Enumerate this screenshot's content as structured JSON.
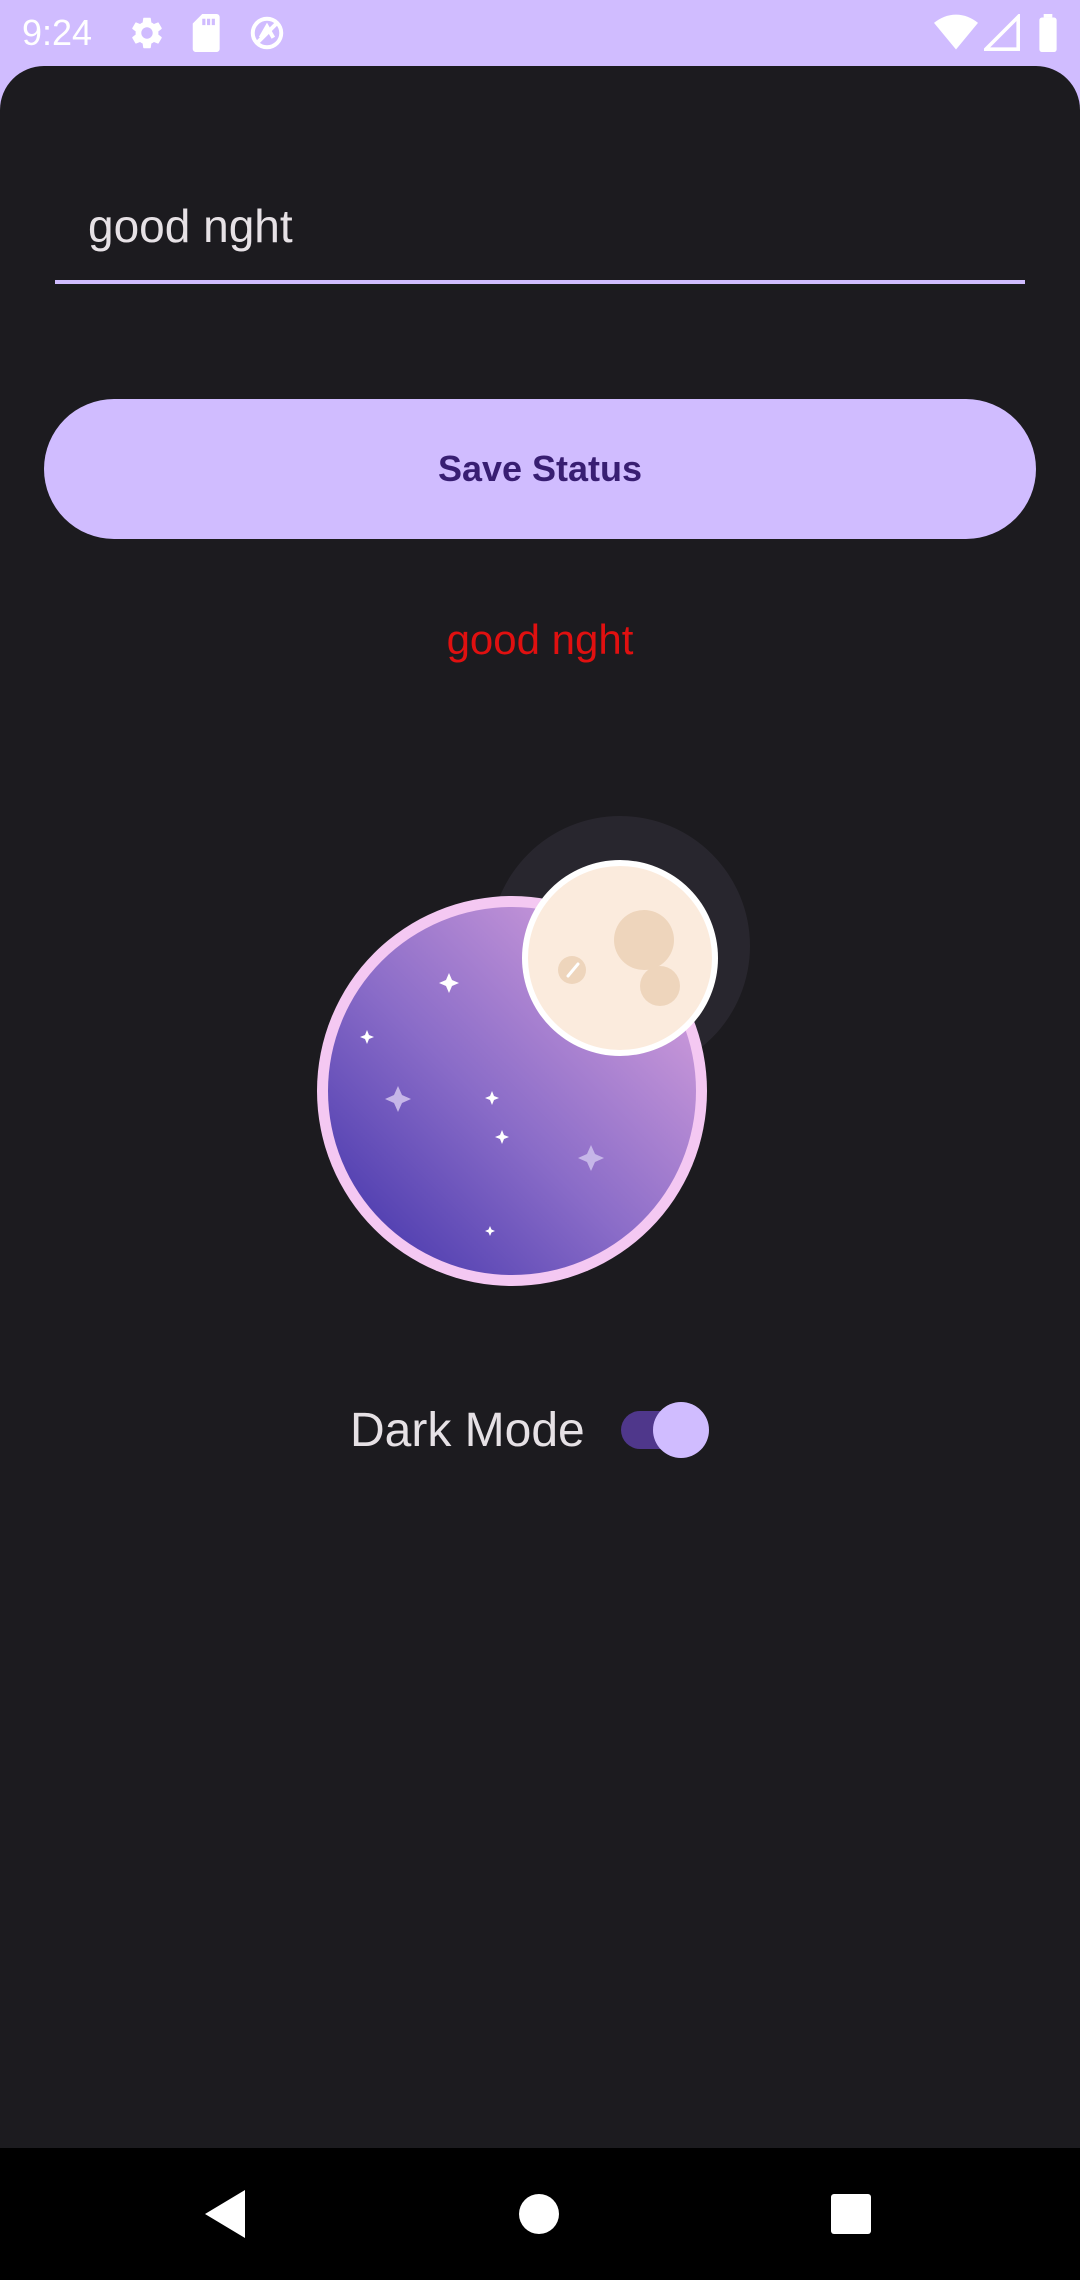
{
  "status_bar": {
    "time": "9:24",
    "icons": [
      "settings-icon",
      "sd-card-icon",
      "vpn-icon",
      "wifi-icon",
      "cell-signal-icon",
      "battery-icon"
    ]
  },
  "status_input": {
    "value": "good nght"
  },
  "save_button": {
    "label": "Save Status"
  },
  "status_display": {
    "text": "good nght",
    "color": "#E01010"
  },
  "dark_mode": {
    "label": "Dark Mode",
    "enabled": true
  },
  "colors": {
    "accent": "#D0BCFF",
    "background": "#1C1B1F",
    "button_text": "#381E72",
    "switch_track": "#4F378B"
  },
  "nav_bar": {
    "icons": [
      "back-icon",
      "home-icon",
      "recents-icon"
    ]
  }
}
